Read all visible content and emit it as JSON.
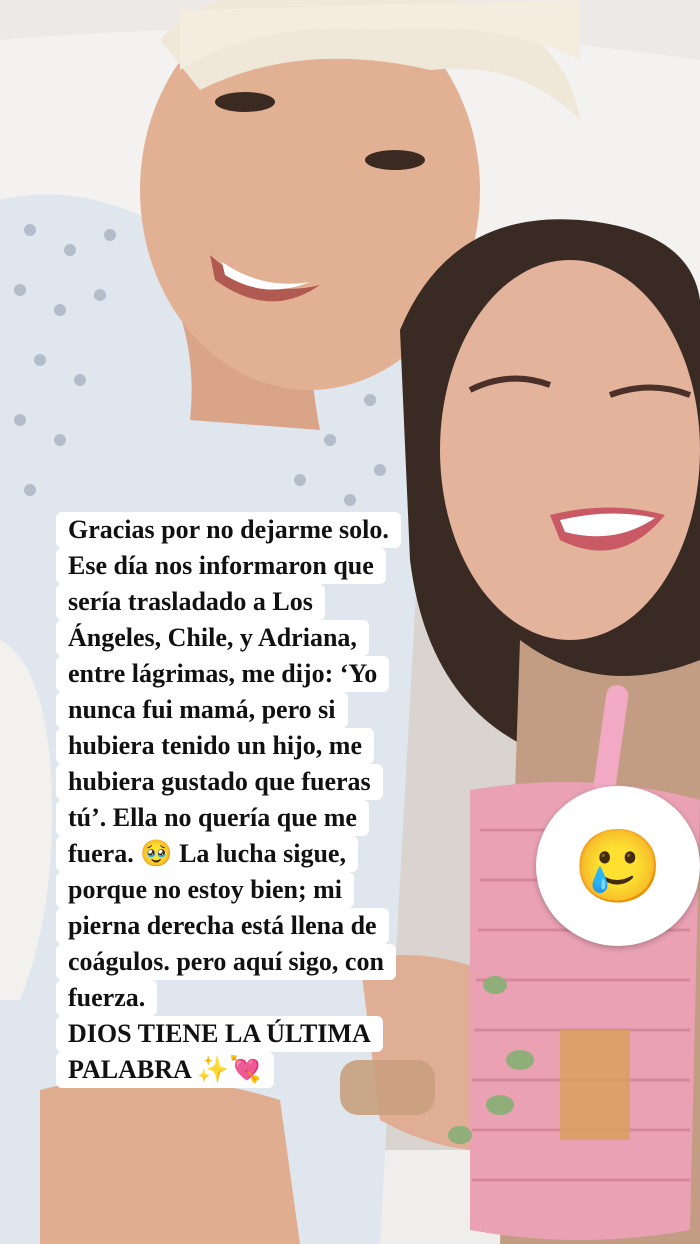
{
  "caption": {
    "lines": [
      "Gracias por no dejarme solo.",
      "Ese día nos informaron que",
      "sería trasladado a Los",
      "Ángeles, Chile, y Adriana,",
      "entre lágrimas, me dijo: ‘Yo",
      "nunca fui mamá, pero si",
      "hubiera tenido un hijo, me",
      "hubiera gustado que fueras",
      "tú’. Ella no quería que me",
      "fuera. 🥹 La lucha sigue,",
      "porque no estoy bien; mi",
      "pierna derecha está llena de",
      "coágulos. pero aquí sigo, con",
      "fuerza.",
      "DIOS TIENE LA ÚLTIMA",
      "PALABRA ✨💘"
    ]
  },
  "sticker": {
    "emoji": "🥲",
    "icon": "smiling-face-with-tear-icon"
  },
  "colors": {
    "caption_bg": "#ffffff",
    "caption_text": "#111111",
    "cup": "#e9a1b3",
    "straw": "#f2a9c4",
    "gown": "#dfe6ee"
  }
}
